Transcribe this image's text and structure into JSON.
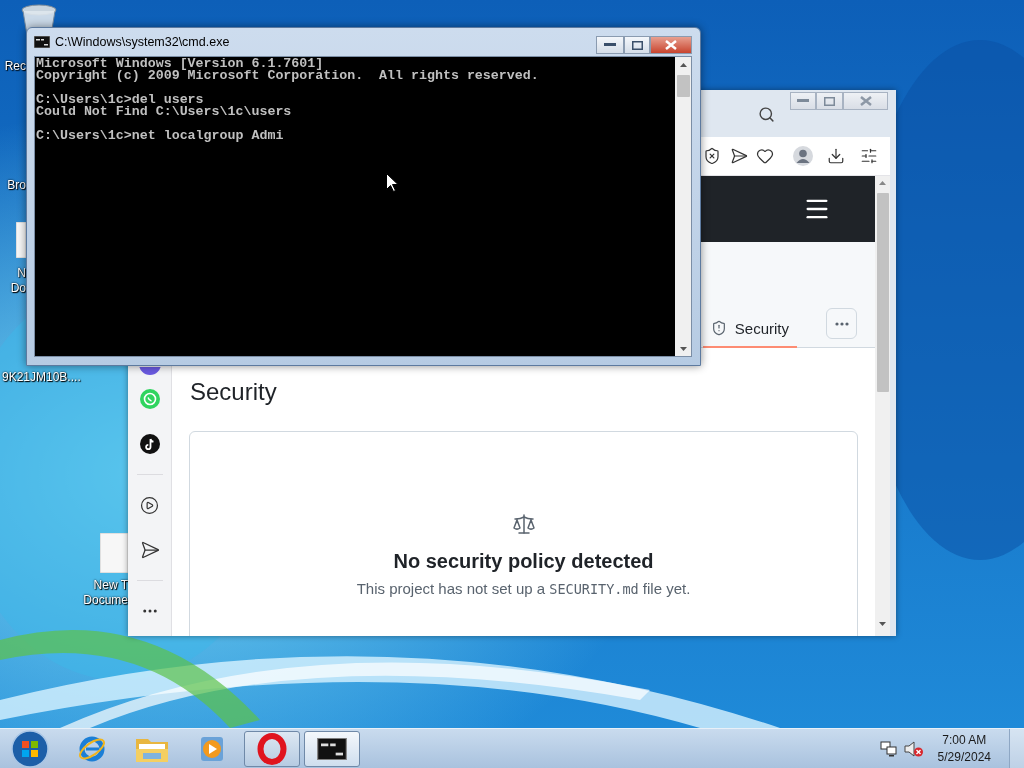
{
  "desktop": {
    "icons": [
      {
        "kind": "recycle-bin",
        "label_lines": [
          "Rec"
        ]
      },
      {
        "label_lines": [
          "Bro"
        ]
      },
      {
        "kind": "document",
        "label_lines": [
          "N",
          "Do"
        ]
      },
      {
        "label_lines": [
          "9K21JM10B...."
        ]
      },
      {
        "kind": "document",
        "label_lines": [
          "New T",
          "Docume"
        ]
      }
    ]
  },
  "browser": {
    "tabs": [
      {
        "label": "Security",
        "selected": true
      }
    ],
    "heading": "Security",
    "empty_state": {
      "title": "No security policy detected",
      "text_before": "This project has not set up a ",
      "code": "SECURITY.md",
      "text_after": " file yet."
    }
  },
  "cmd": {
    "title": "C:\\Windows\\system32\\cmd.exe",
    "blocks": [
      [
        "Microsoft Windows [Version 6.1.7601]",
        "Copyright (c) 2009 Microsoft Corporation.  All rights reserved."
      ],
      [
        "C:\\Users\\1c>del users",
        "Could Not Find C:\\Users\\1c\\users"
      ],
      [
        "C:\\Users\\1c>net localgroup Admi"
      ]
    ]
  },
  "taskbar": {
    "apps": [
      {
        "kind": "ie",
        "running": false,
        "active": false
      },
      {
        "kind": "explorer",
        "running": false,
        "active": false
      },
      {
        "kind": "media-player",
        "running": false,
        "active": false
      },
      {
        "kind": "opera",
        "running": true,
        "active": false
      },
      {
        "kind": "cmd",
        "running": true,
        "active": true
      }
    ],
    "tray": {
      "volume_muted": true,
      "time": "7:00 AM",
      "date": "5/29/2024"
    }
  }
}
